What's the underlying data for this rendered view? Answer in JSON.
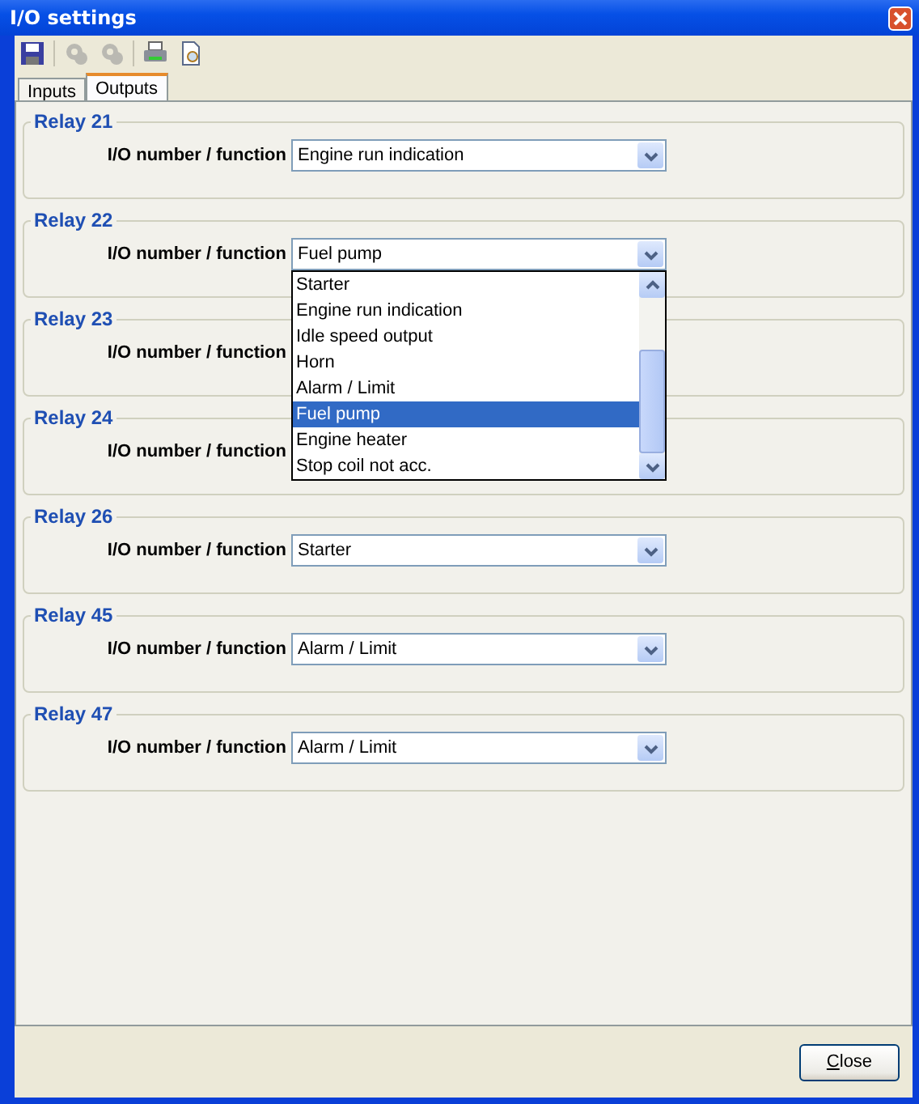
{
  "window": {
    "title": "I/O settings"
  },
  "toolbar": [
    {
      "kind": "save",
      "disabled": false
    },
    {
      "kind": "gear",
      "disabled": true
    },
    {
      "kind": "gear",
      "disabled": true
    },
    {
      "kind": "print",
      "disabled": false
    },
    {
      "kind": "preview",
      "disabled": false
    }
  ],
  "tabs": [
    {
      "label": "Inputs",
      "selected": false
    },
    {
      "label": "Outputs",
      "selected": true
    }
  ],
  "relays": [
    {
      "title": "Relay 21",
      "label": "I/O number / function",
      "value": "Engine run indication"
    },
    {
      "title": "Relay 22",
      "label": "I/O number / function",
      "value": "Fuel pump",
      "expanded": true,
      "options": [
        {
          "label": "Starter",
          "selected": false
        },
        {
          "label": "Engine run indication",
          "selected": false
        },
        {
          "label": "Idle speed output",
          "selected": false
        },
        {
          "label": "Horn",
          "selected": false
        },
        {
          "label": "Alarm / Limit",
          "selected": false
        },
        {
          "label": "Fuel pump",
          "selected": true
        },
        {
          "label": "Engine heater",
          "selected": false
        },
        {
          "label": "Stop coil not acc.",
          "selected": false
        }
      ]
    },
    {
      "title": "Relay 23",
      "label": "I/O number / function"
    },
    {
      "title": "Relay 24",
      "label": "I/O number / function"
    },
    {
      "title": "Relay 26",
      "label": "I/O number / function",
      "value": "Starter"
    },
    {
      "title": "Relay 45",
      "label": "I/O number / function",
      "value": "Alarm / Limit"
    },
    {
      "title": "Relay 47",
      "label": "I/O number / function",
      "value": "Alarm / Limit"
    }
  ],
  "close_button": {
    "label": "Close",
    "mnemonic_underlined": true
  }
}
